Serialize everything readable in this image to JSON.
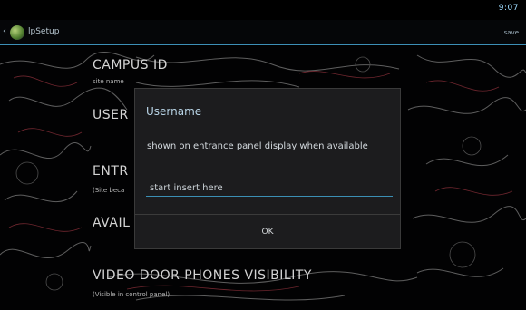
{
  "statusbar": {
    "time": "9:07"
  },
  "actionbar": {
    "title": "lpSetup",
    "right_label": "save"
  },
  "preferences": [
    {
      "title": "CAMPUS ID",
      "subtitle": "site name"
    },
    {
      "title": "USER",
      "subtitle": ""
    },
    {
      "title": "ENTR",
      "subtitle": "(Site beca"
    },
    {
      "title": "AVAIL",
      "subtitle": ""
    },
    {
      "title": "VIDEO DOOR PHONES VISIBILITY",
      "subtitle": "(Visible in control panel)"
    }
  ],
  "dialog": {
    "title": "Username",
    "message": "shown on entrance panel display when available",
    "input_placeholder": "start insert here",
    "ok_label": "OK"
  },
  "colors": {
    "accent": "#3b8fb4",
    "background": "#000000",
    "dialog": "#1c1c1e"
  }
}
